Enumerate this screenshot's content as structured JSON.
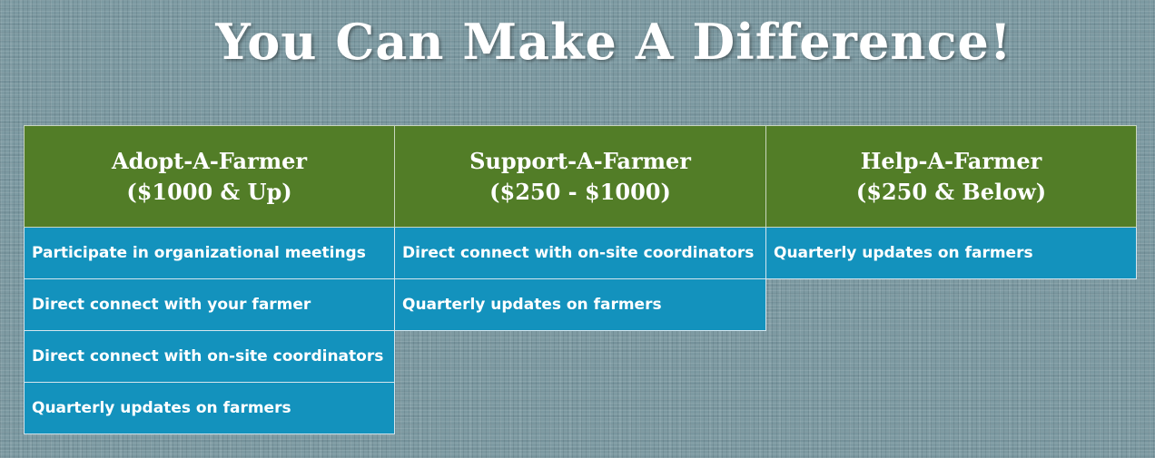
{
  "title": "You Can Make A Difference!",
  "tiers": [
    {
      "name": "Adopt-A-Farmer",
      "range": "($1000 & Up)",
      "benefits": [
        "Participate in organizational meetings",
        "Direct connect with your farmer",
        "Direct connect with on-site coordinators",
        "Quarterly updates on farmers"
      ]
    },
    {
      "name": "Support-A-Farmer",
      "range": "($250 - $1000)",
      "benefits": [
        "Direct connect with on-site coordinators",
        "Quarterly updates on farmers"
      ]
    },
    {
      "name": "Help-A-Farmer",
      "range": "($250 & Below)",
      "benefits": [
        "Quarterly updates on farmers"
      ]
    }
  ],
  "colors": {
    "background": "#7d9aa2",
    "header_green": "#527d27",
    "benefit_blue": "#1392bd",
    "text": "#ffffff"
  }
}
